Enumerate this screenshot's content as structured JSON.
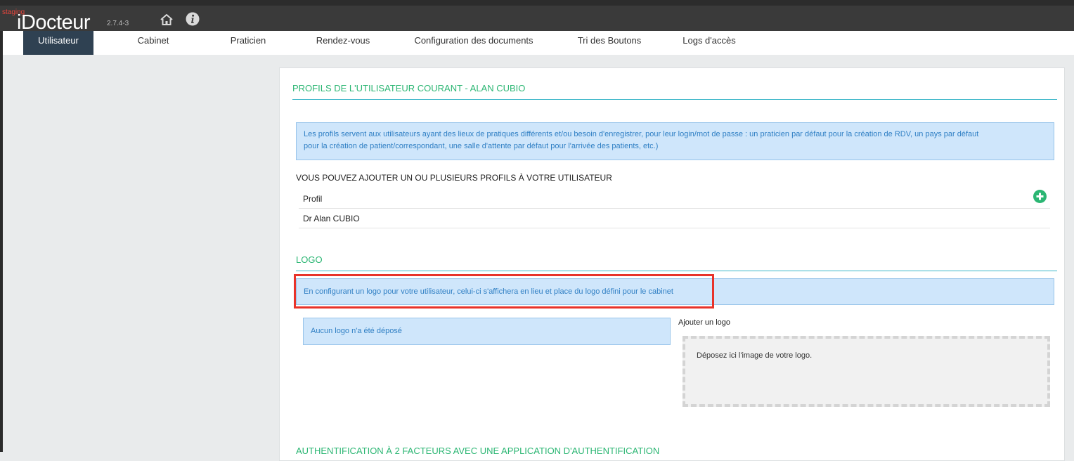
{
  "app": {
    "env_label": "staging",
    "brand": "iDocteur",
    "version": "2.7.4-3",
    "home_icon": "home-icon",
    "info_icon": "info-icon"
  },
  "tabs": [
    {
      "label": "Utilisateur",
      "active": true
    },
    {
      "label": "Cabinet"
    },
    {
      "label": "Praticien"
    },
    {
      "label": "Rendez-vous"
    },
    {
      "label": "Configuration des documents"
    },
    {
      "label": "Tri des Boutons"
    },
    {
      "label": "Logs d'accès"
    }
  ],
  "profiles": {
    "title": "PROFILS DE L'UTILISATEUR COURANT - ALAN CUBIO",
    "info_line1": "Les profils servent aux utilisateurs ayant des lieux de pratiques différents et/ou besoin d'enregistrer, pour leur login/mot de passe : un praticien par défaut pour la création de RDV, un pays par défaut",
    "info_line2": "pour la création de patient/correspondant, une salle d'attente par défaut pour l'arrivée des patients, etc.)",
    "add_heading": "VOUS POUVEZ AJOUTER UN OU PLUSIEURS PROFILS À VOTRE UTILISATEUR",
    "column_header": "Profil",
    "rows": [
      "Dr Alan CUBIO"
    ]
  },
  "logo": {
    "title": "LOGO",
    "info": "En configurant un logo pour votre utilisateur, celui-ci s'affichera en lieu et place du logo défini pour le cabinet",
    "no_logo": "Aucun logo n'a été déposé",
    "add_label": "Ajouter un logo",
    "dropzone_text": "Déposez ici l'image de votre logo."
  },
  "twofa": {
    "title": "AUTHENTIFICATION À 2 FACTEURS AVEC UNE APPLICATION D'AUTHENTIFICATION"
  },
  "colors": {
    "accent_green": "#2bb673",
    "tab_active": "#2f4152",
    "info_bg": "#cfe6fb",
    "highlight": "#e8332a"
  }
}
